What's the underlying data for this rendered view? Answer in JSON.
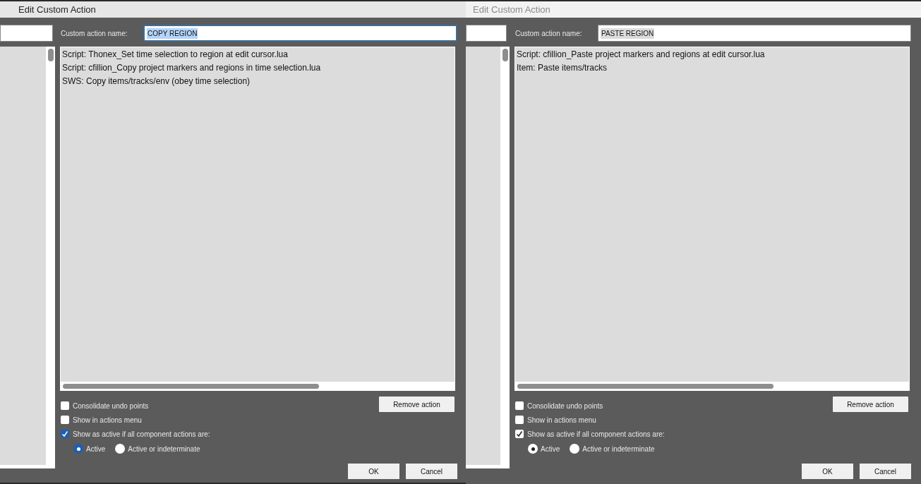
{
  "dialogs": [
    {
      "title": "Edit Custom Action",
      "focused": true,
      "name_label": "Custom action name:",
      "name_value": "COPY REGION",
      "name_text_selected": true,
      "actions": [
        "Script: Thonex_Set time selection to region at edit cursor.lua",
        "Script: cfillion_Copy project markers and regions in time selection.lua",
        "SWS: Copy items/tracks/env (obey time selection)"
      ],
      "options": [
        {
          "label": "Consolidate undo points",
          "checked": false
        },
        {
          "label": "Show in actions menu",
          "checked": false
        },
        {
          "label": "Show as active if all component actions are:",
          "checked": true
        }
      ],
      "radios": [
        {
          "label": "Active",
          "selected": true
        },
        {
          "label": "Active or indeterminate",
          "selected": false
        }
      ],
      "remove_button": "Remove action",
      "ok_button": "OK",
      "cancel_button": "Cancel"
    },
    {
      "title": "Edit Custom Action",
      "focused": false,
      "name_label": "Custom action name:",
      "name_value": "PASTE REGION",
      "name_text_selected": true,
      "actions": [
        "Script: cfillion_Paste project markers and regions at edit cursor.lua",
        "Item: Paste items/tracks"
      ],
      "options": [
        {
          "label": "Consolidate undo points",
          "checked": false
        },
        {
          "label": "Show in actions menu",
          "checked": false
        },
        {
          "label": "Show as active if all component actions are:",
          "checked": true
        }
      ],
      "radios": [
        {
          "label": "Active",
          "selected": true
        },
        {
          "label": "Active or indeterminate",
          "selected": false
        }
      ],
      "remove_button": "Remove action",
      "ok_button": "OK",
      "cancel_button": "Cancel"
    }
  ]
}
